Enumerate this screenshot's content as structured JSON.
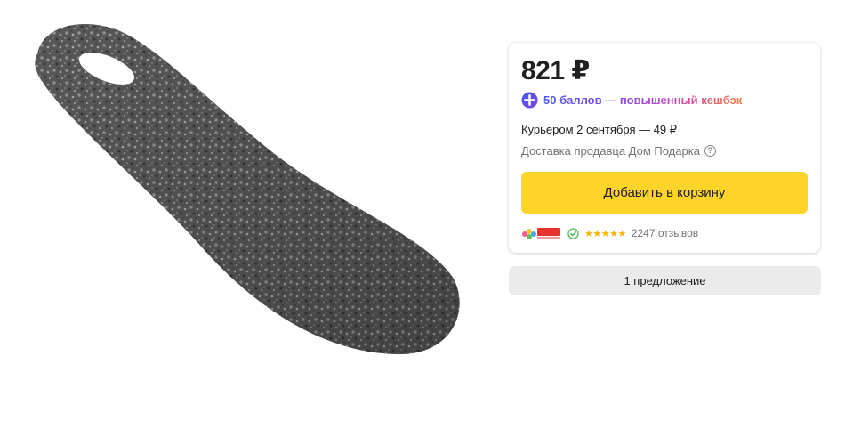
{
  "product": {
    "image_icon": "shoehorn-image"
  },
  "offer": {
    "price": "821 ₽",
    "plus_icon": "plus-icon",
    "cashback": "50 баллов — повышенный кешбэк",
    "delivery": "Курьером 2 сентября — 49 ₽",
    "seller_delivery": "Доставка продавца Дом Подарка",
    "help_icon": "?",
    "cart_button": "Добавить в корзину",
    "shop_logo_icon": "shop-logo",
    "verified_icon": "verified-check-icon",
    "rating_stars": "★★★★★",
    "rating_value": 5,
    "reviews": "2247 отзывов"
  },
  "offers_button": "1 предложение",
  "colors": {
    "cart_button": "#fed42b",
    "offers_button": "#ebebeb",
    "star": "#f7b500",
    "plus_gradient_start": "#4c5bf0",
    "plus_gradient_end": "#f07c38"
  }
}
